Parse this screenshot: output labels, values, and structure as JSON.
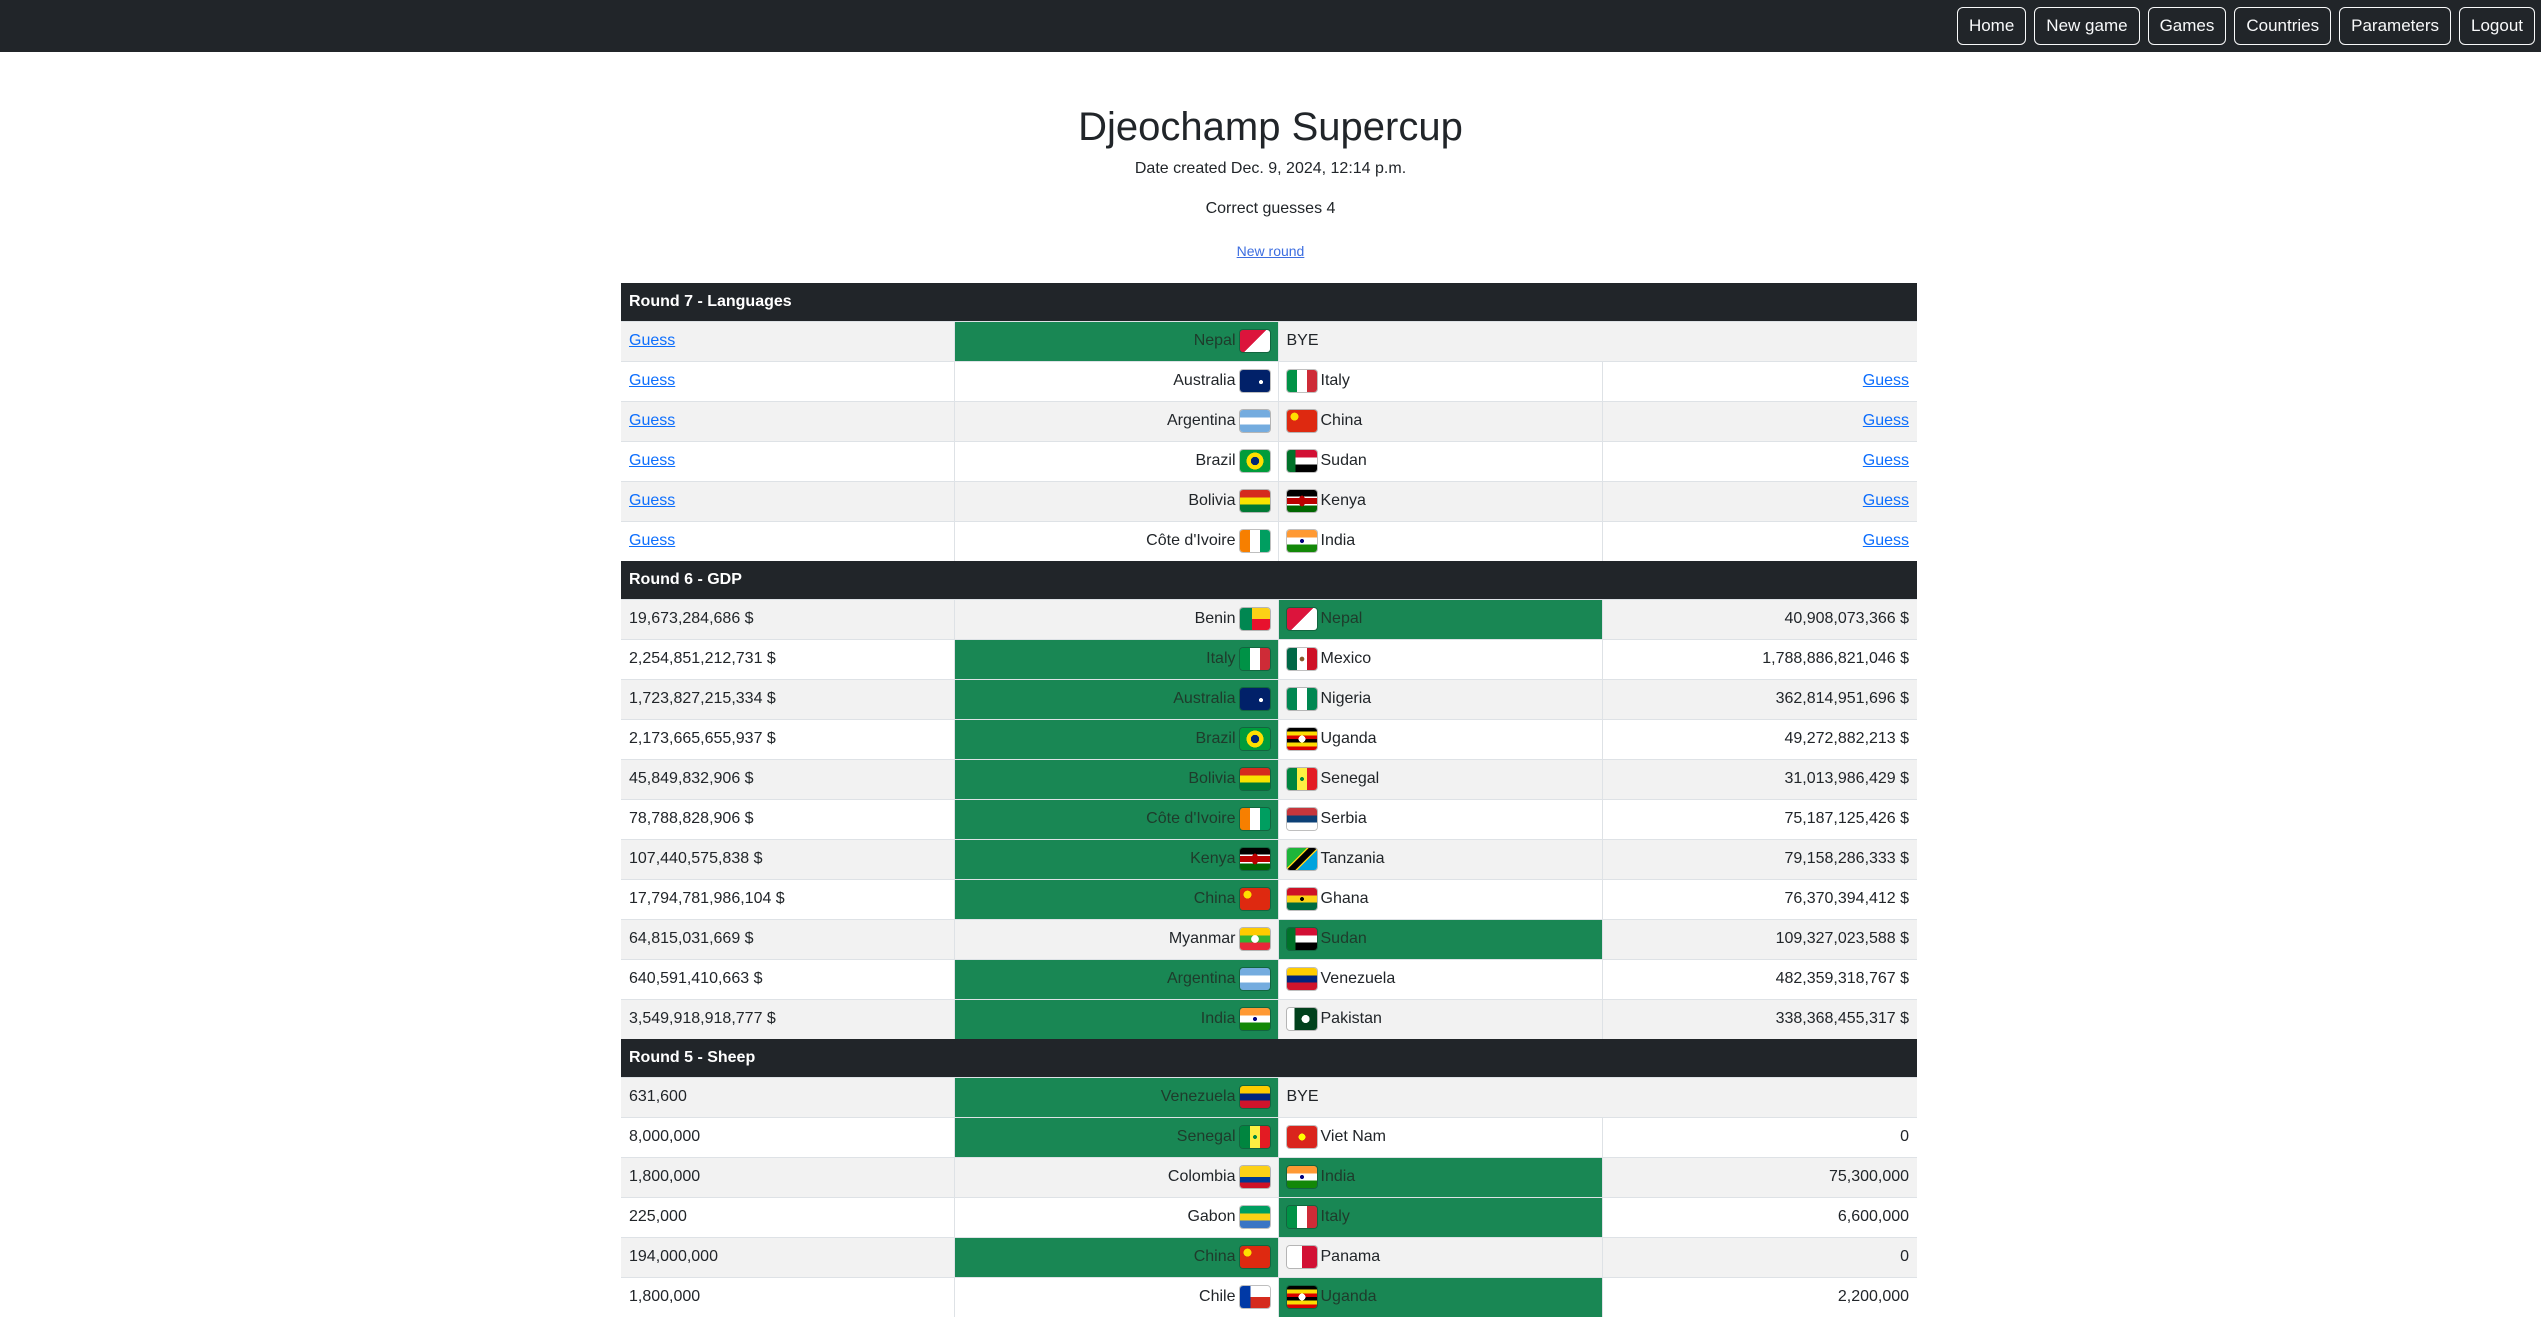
{
  "nav": [
    "Home",
    "New game",
    "Games",
    "Countries",
    "Parameters",
    "Logout"
  ],
  "header": {
    "title": "Djeochamp Supercup",
    "date": "Date created Dec. 9, 2024, 12:14 p.m.",
    "guesses": "Correct guesses 4",
    "new_round": "New round"
  },
  "rounds": [
    {
      "title": "Round 7 - Languages",
      "matches": [
        {
          "lval": "Guess",
          "lname": "Nepal",
          "lflag": "nepal",
          "rname": "BYE",
          "rflag": "",
          "rval": "",
          "winner": "left"
        },
        {
          "lval": "Guess",
          "lname": "Australia",
          "lflag": "australia",
          "rname": "Italy",
          "rflag": "italy",
          "rval": "Guess",
          "winner": ""
        },
        {
          "lval": "Guess",
          "lname": "Argentina",
          "lflag": "argentina",
          "rname": "China",
          "rflag": "china",
          "rval": "Guess",
          "winner": ""
        },
        {
          "lval": "Guess",
          "lname": "Brazil",
          "lflag": "brazil",
          "rname": "Sudan",
          "rflag": "sudan",
          "rval": "Guess",
          "winner": ""
        },
        {
          "lval": "Guess",
          "lname": "Bolivia",
          "lflag": "bolivia",
          "rname": "Kenya",
          "rflag": "kenya",
          "rval": "Guess",
          "winner": ""
        },
        {
          "lval": "Guess",
          "lname": "Côte d'Ivoire",
          "lflag": "ivorycoast",
          "rname": "India",
          "rflag": "india",
          "rval": "Guess",
          "winner": ""
        }
      ]
    },
    {
      "title": "Round 6 - GDP",
      "matches": [
        {
          "lval": "19,673,284,686 $",
          "lname": "Benin",
          "lflag": "benin",
          "rname": "Nepal",
          "rflag": "nepal",
          "rval": "40,908,073,366 $",
          "winner": "right"
        },
        {
          "lval": "2,254,851,212,731 $",
          "lname": "Italy",
          "lflag": "italy",
          "rname": "Mexico",
          "rflag": "mexico",
          "rval": "1,788,886,821,046 $",
          "winner": "left"
        },
        {
          "lval": "1,723,827,215,334 $",
          "lname": "Australia",
          "lflag": "australia",
          "rname": "Nigeria",
          "rflag": "nigeria",
          "rval": "362,814,951,696 $",
          "winner": "left"
        },
        {
          "lval": "2,173,665,655,937 $",
          "lname": "Brazil",
          "lflag": "brazil",
          "rname": "Uganda",
          "rflag": "uganda",
          "rval": "49,272,882,213 $",
          "winner": "left"
        },
        {
          "lval": "45,849,832,906 $",
          "lname": "Bolivia",
          "lflag": "bolivia",
          "rname": "Senegal",
          "rflag": "senegal",
          "rval": "31,013,986,429 $",
          "winner": "left"
        },
        {
          "lval": "78,788,828,906 $",
          "lname": "Côte d'Ivoire",
          "lflag": "ivorycoast",
          "rname": "Serbia",
          "rflag": "serbia",
          "rval": "75,187,125,426 $",
          "winner": "left"
        },
        {
          "lval": "107,440,575,838 $",
          "lname": "Kenya",
          "lflag": "kenya",
          "rname": "Tanzania",
          "rflag": "tanzania",
          "rval": "79,158,286,333 $",
          "winner": "left"
        },
        {
          "lval": "17,794,781,986,104 $",
          "lname": "China",
          "lflag": "china",
          "rname": "Ghana",
          "rflag": "ghana",
          "rval": "76,370,394,412 $",
          "winner": "left"
        },
        {
          "lval": "64,815,031,669 $",
          "lname": "Myanmar",
          "lflag": "myanmar",
          "rname": "Sudan",
          "rflag": "sudan",
          "rval": "109,327,023,588 $",
          "winner": "right"
        },
        {
          "lval": "640,591,410,663 $",
          "lname": "Argentina",
          "lflag": "argentina",
          "rname": "Venezuela",
          "rflag": "venezuela",
          "rval": "482,359,318,767 $",
          "winner": "left"
        },
        {
          "lval": "3,549,918,918,777 $",
          "lname": "India",
          "lflag": "india",
          "rname": "Pakistan",
          "rflag": "pakistan",
          "rval": "338,368,455,317 $",
          "winner": "left"
        }
      ]
    },
    {
      "title": "Round 5 - Sheep",
      "matches": [
        {
          "lval": "631,600",
          "lname": "Venezuela",
          "lflag": "venezuela",
          "rname": "BYE",
          "rflag": "",
          "rval": "",
          "winner": "left"
        },
        {
          "lval": "8,000,000",
          "lname": "Senegal",
          "lflag": "senegal",
          "rname": "Viet Nam",
          "rflag": "vietnam",
          "rval": "0",
          "winner": "left"
        },
        {
          "lval": "1,800,000",
          "lname": "Colombia",
          "lflag": "colombia",
          "rname": "India",
          "rflag": "india",
          "rval": "75,300,000",
          "winner": "right"
        },
        {
          "lval": "225,000",
          "lname": "Gabon",
          "lflag": "gabon",
          "rname": "Italy",
          "rflag": "italy",
          "rval": "6,600,000",
          "winner": "right"
        },
        {
          "lval": "194,000,000",
          "lname": "China",
          "lflag": "china",
          "rname": "Panama",
          "rflag": "panama",
          "rval": "0",
          "winner": "left"
        },
        {
          "lval": "1,800,000",
          "lname": "Chile",
          "lflag": "chile",
          "rname": "Uganda",
          "rflag": "uganda",
          "rval": "2,200,000",
          "winner": "right"
        }
      ]
    }
  ]
}
